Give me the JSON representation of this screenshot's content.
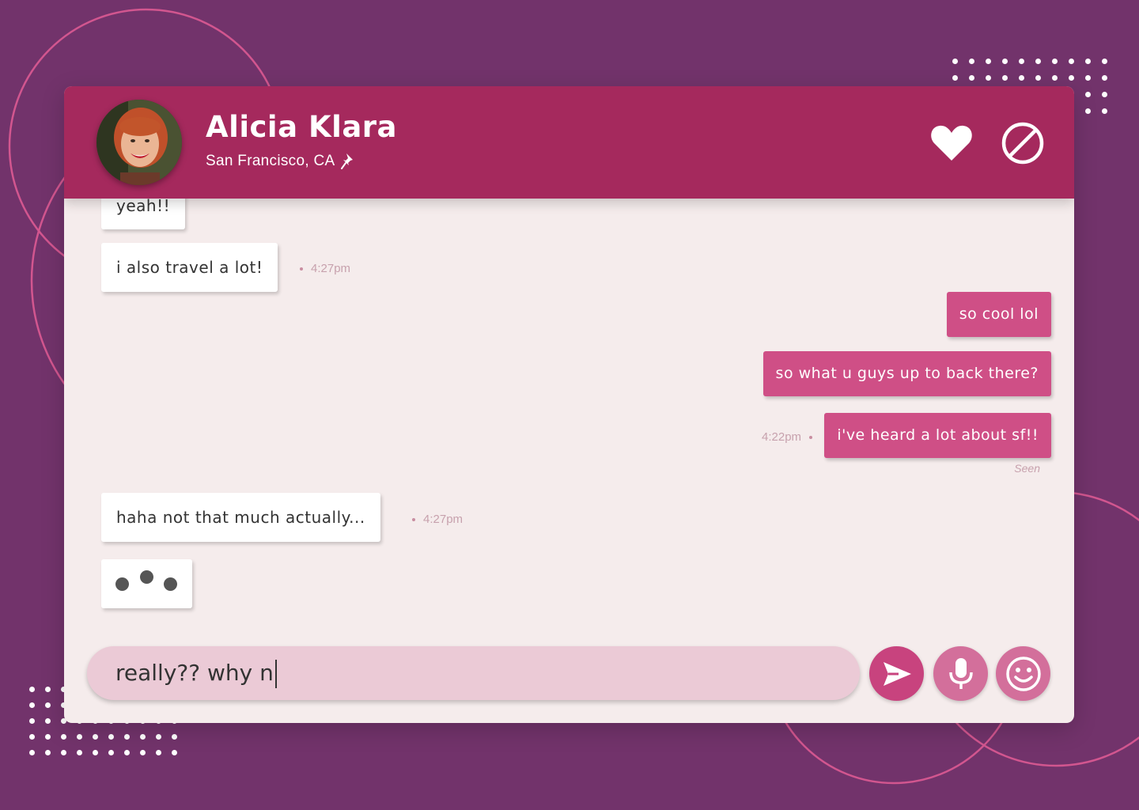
{
  "contact": {
    "name": "Alicia Klara",
    "location": "San Francisco, CA"
  },
  "header_actions": {
    "like_icon": "heart-icon",
    "block_icon": "block-icon"
  },
  "messages": [
    {
      "from": "contact",
      "text": "yeah!!",
      "time": ""
    },
    {
      "from": "contact",
      "text": "i also travel a lot!",
      "time": "4:27pm"
    },
    {
      "from": "me",
      "text": "so cool lol",
      "time": ""
    },
    {
      "from": "me",
      "text": "so what u guys up to back there?",
      "time": ""
    },
    {
      "from": "me",
      "text": "i've heard a lot about sf!!",
      "time": "4:22pm",
      "status": "Seen"
    },
    {
      "from": "contact",
      "text": "haha not that much actually...",
      "time": "4:27pm"
    }
  ],
  "typing_indicator": true,
  "composer": {
    "value": "really?? why n"
  },
  "colors": {
    "background": "#72336b",
    "header": "#a5295d",
    "outgoing_bubble": "#cf4f86",
    "composer": "#ebcad6"
  }
}
